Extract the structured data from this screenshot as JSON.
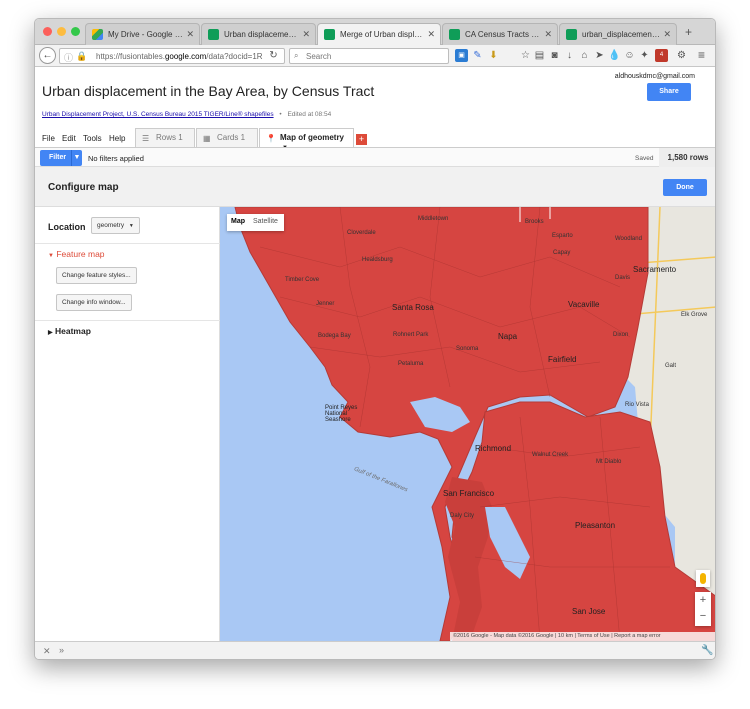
{
  "browser": {
    "tabs": [
      {
        "label": "My Drive - Google Drive",
        "color": "#34a853"
      },
      {
        "label": "Urban displacement in t...",
        "color": "#0f9d58"
      },
      {
        "label": "Merge of Urban displace...",
        "color": "#0f9d58"
      },
      {
        "label": "CA Census Tracts - Goo...",
        "color": "#0f9d58"
      },
      {
        "label": "urban_displacement.xlsx...",
        "color": "#0f9d58"
      }
    ],
    "new_tab": "+",
    "url_prefix": "https://fusiontables.",
    "url_domain": "google.com",
    "url_suffix": "/data?docid=1R",
    "search_placeholder": "Search",
    "badge_count": "4"
  },
  "header": {
    "account": "aldhouskdmc@gmail.com",
    "share_label": "Share",
    "title": "Urban displacement in the Bay Area, by Census Tract",
    "source_link": "Urban Displacement Project, U.S. Census Bureau 2015 TIGER/Line® shapefiles",
    "edited": "Edited at 08:54"
  },
  "menu": {
    "items": [
      "File",
      "Edit",
      "Tools",
      "Help"
    ],
    "tabs": [
      "Rows 1",
      "Cards 1",
      "Map of geometry"
    ],
    "add_tab": "+"
  },
  "filterbar": {
    "filter_label": "Filter",
    "status": "No filters applied",
    "saved": "Saved",
    "rows": "1,580 rows"
  },
  "config": {
    "title": "Configure map",
    "done_label": "Done",
    "location_label": "Location",
    "location_value": "geometry",
    "feature_map": "Feature map",
    "change_styles": "Change feature styles...",
    "change_info": "Change info window...",
    "heatmap": "Heatmap"
  },
  "map": {
    "map_btn": "Map",
    "satellite_btn": "Satellite",
    "zoom_in": "+",
    "zoom_out": "−",
    "footer": "©2016 Google - Map data ©2016 Google  |  10 km  |  Terms of Use  |  Report a map error",
    "overlay_color": "#d64541",
    "labels": {
      "sacramento": "Sacramento",
      "santa_rosa": "Santa Rosa",
      "napa": "Napa",
      "vacaville": "Vacaville",
      "fairfield": "Fairfield",
      "richmond": "Richmond",
      "san_francisco": "San Francisco",
      "pleasanton": "Pleasanton",
      "san_jose": "San Jose",
      "petaluma": "Petaluma",
      "gulf": "Gulf of the Farallones",
      "woodland": "Woodland",
      "davis": "Davis",
      "brooks": "Brooks",
      "middletown": "Middletown",
      "cloverdale": "Cloverdale",
      "healdsburg": "Healdsburg",
      "sonoma": "Sonoma",
      "dixon": "Dixon",
      "elk_grove": "Elk Grove",
      "walnut_creek": "Walnut Creek",
      "daly_city": "Daly City",
      "point_reyes": "Point Reyes National Seashore",
      "bodega_bay": "Bodega Bay",
      "timber_cove": "Timber Cove",
      "jenner": "Jenner",
      "rohnert_park": "Rohnert Park",
      "mt_diablo": "Mt Diablo",
      "esparto": "Esparto",
      "galt": "Galt",
      "rio_vista": "Rio Vista",
      "capay": "Capay"
    }
  }
}
